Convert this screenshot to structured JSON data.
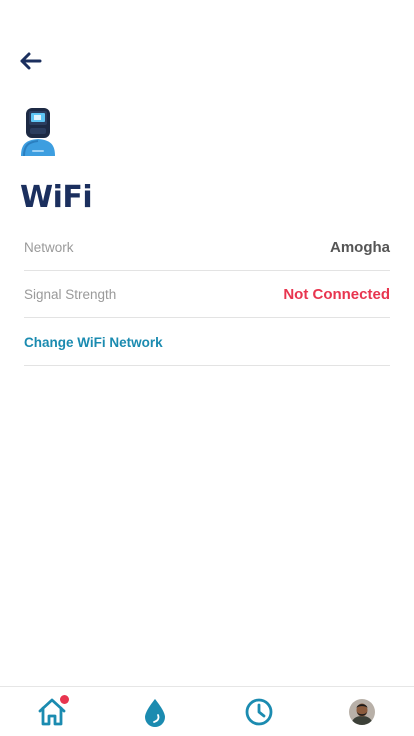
{
  "page": {
    "title": "WiFi"
  },
  "rows": [
    {
      "label": "Network",
      "value": "Amogha"
    },
    {
      "label": "Signal Strength",
      "value": "Not Connected"
    }
  ],
  "change_link": "Change WiFi Network",
  "tabbar": {
    "tabs": [
      {
        "name": "home",
        "icon": "home-icon"
      },
      {
        "name": "water",
        "icon": "water-drop-icon"
      },
      {
        "name": "history",
        "icon": "clock-icon"
      },
      {
        "name": "profile",
        "icon": "avatar"
      }
    ]
  },
  "colors": {
    "title": "#1b2f5e",
    "accent": "#1b8bb0",
    "error": "#e8354f",
    "badge": "#e8354f"
  }
}
